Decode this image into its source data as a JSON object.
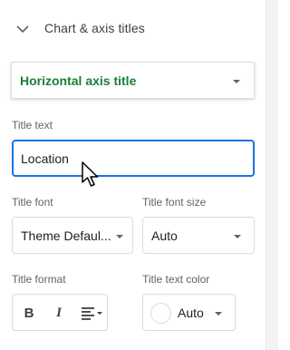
{
  "section": {
    "title": "Chart & axis titles",
    "chevron_icon": "chevron-down-icon"
  },
  "title_type_select": {
    "value": "Horizontal axis title",
    "accent_color": "#188038"
  },
  "title_text": {
    "label": "Title text",
    "value": "Location"
  },
  "title_font": {
    "label": "Title font",
    "value": "Theme Defaul..."
  },
  "title_font_size": {
    "label": "Title font size",
    "value": "Auto"
  },
  "title_format": {
    "label": "Title format",
    "buttons": [
      {
        "name": "bold",
        "icon": "bold-icon",
        "glyph": "B"
      },
      {
        "name": "italic",
        "icon": "italic-icon",
        "glyph": "I"
      },
      {
        "name": "align",
        "icon": "align-icon"
      }
    ]
  },
  "title_text_color": {
    "label": "Title text color",
    "value": "Auto",
    "swatch_color": "#ffffff"
  },
  "colors": {
    "focus_blue": "#1a73e8",
    "border": "#dadce0",
    "label_gray": "#5f6368"
  }
}
